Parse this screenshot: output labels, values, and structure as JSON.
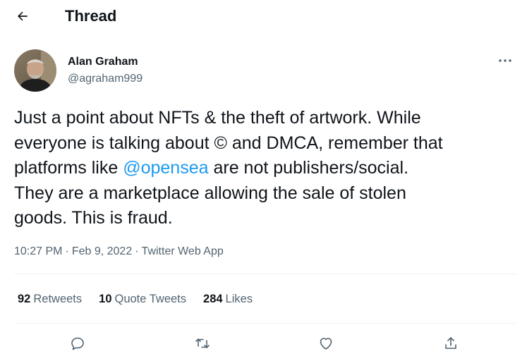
{
  "header": {
    "title": "Thread",
    "back_icon": "arrow-left-icon"
  },
  "author": {
    "name": "Alan Graham",
    "handle": "@agraham999",
    "avatar_icon": "avatar-photo"
  },
  "tweet": {
    "text_before_mention": "Just a point about NFTs & the theft of artwork. While\neveryone is talking about © and DMCA, remember that\nplatforms like ",
    "mention": "@opensea",
    "text_after_mention": " are not publishers/social.\nThey are a marketplace allowing the sale of stolen\ngoods. This is fraud."
  },
  "meta": {
    "time": "10:27 PM",
    "separator": "·",
    "date": "Feb 9, 2022",
    "source": "Twitter Web App"
  },
  "stats": {
    "retweets_count": "92",
    "retweets_label": "Retweets",
    "quotes_count": "10",
    "quotes_label": "Quote Tweets",
    "likes_count": "284",
    "likes_label": "Likes"
  },
  "actions": {
    "reply_icon": "reply-icon",
    "retweet_icon": "retweet-icon",
    "like_icon": "heart-icon",
    "share_icon": "share-icon"
  },
  "colors": {
    "text": "#0f1419",
    "secondary": "#536471",
    "link": "#1d9bf0",
    "divider": "#eff3f4"
  }
}
